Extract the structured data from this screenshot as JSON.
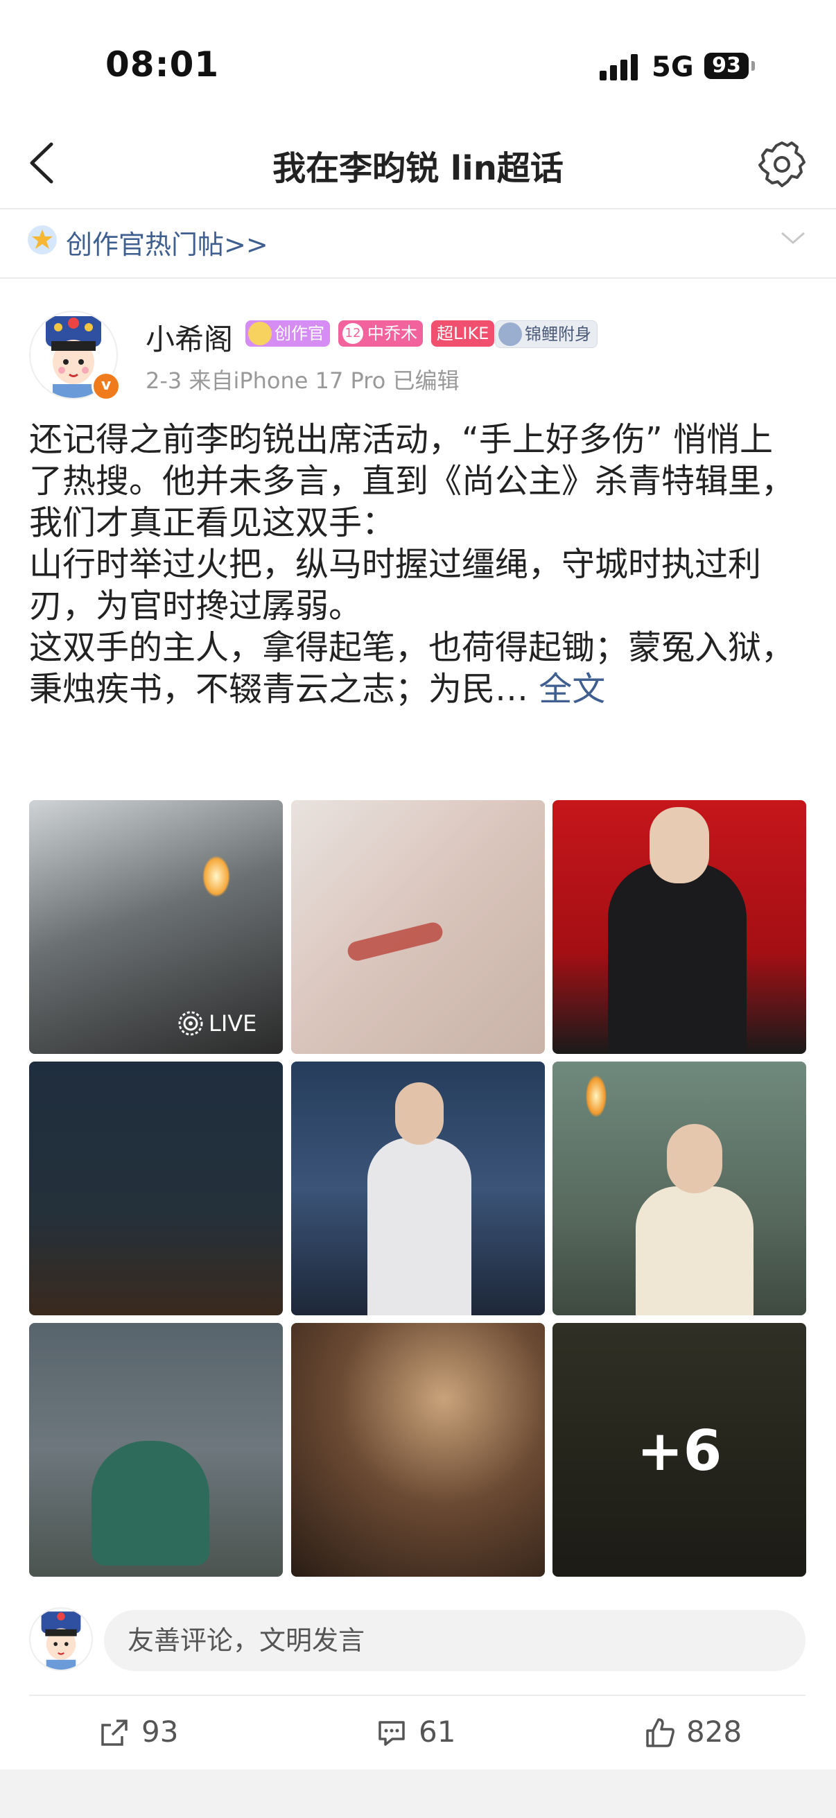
{
  "status_bar": {
    "time": "08:01",
    "network": "5G",
    "battery": "93"
  },
  "nav": {
    "title": "我在李昀锐 lin超话"
  },
  "hot_bar": {
    "label": "创作官热门帖>>"
  },
  "post": {
    "username": "小希阁",
    "badges": [
      {
        "label": "创作官",
        "color": "#d58cf3"
      },
      {
        "label": "中乔木",
        "color": "#f2639d"
      },
      {
        "label": "超LIKE",
        "color": "#f0506e"
      },
      {
        "label": "锦鲤附身",
        "color": "#e9edf2"
      }
    ],
    "badge_level": "12",
    "verified_mark": "v",
    "meta": "2-3  来自iPhone 17 Pro  已编辑",
    "paragraphs": [
      "还记得之前李昀锐出席活动，“手上好多伤” 悄悄上了热搜。他并未多言，直到《尚公主》杀青特辑里，我们才真正看见这双手：",
      "山行时举过火把，纵马时握过缰绳，守城时执过利刃，为官时搀过孱弱。",
      "这双手的主人，拿得起笔，也荷得起锄；蒙冤入狱，秉烛疾书，不辍青云之志；为民… "
    ],
    "full_text_link": "全文",
    "live_label": "LIVE",
    "more_images": "+6"
  },
  "comment": {
    "placeholder": "友善评论，文明发言"
  },
  "actions": {
    "share": "93",
    "comment": "61",
    "like": "828"
  }
}
